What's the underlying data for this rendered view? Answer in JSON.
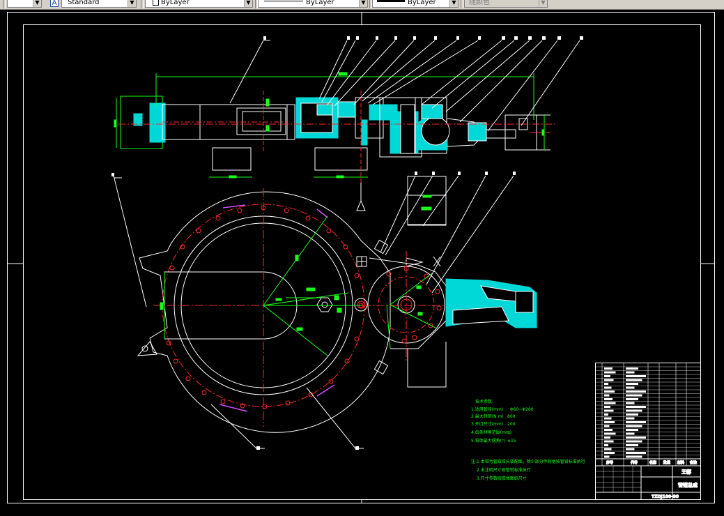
{
  "toolbar": {
    "text_style": {
      "value": "Standard"
    },
    "color_control": {
      "value": "ByLayer"
    },
    "linetype_control": {
      "value": "ByLayer"
    },
    "lineweight_control": {
      "value": "ByLayer"
    },
    "plotstyle_control": {
      "value": "随颜色"
    }
  },
  "icons": {
    "text_style_icon": "text-style-icon",
    "dropdown_arrow": "chevron-down-icon"
  },
  "colors": {
    "background": "#000000",
    "lines": "#ffffff",
    "dimensions": "#19ff19",
    "centerlines": "#ff2a2a",
    "section_fill": "#00d8d8",
    "leaders": "#ffffff",
    "accent_magenta": "#d24bff"
  },
  "drawing": {
    "notes": {
      "heading": "技术参数:",
      "lines": [
        {
          "label": "1.适用管径(mm)",
          "value": "Φ60~Φ200"
        },
        {
          "label": "2.最大转矩(N.m)",
          "value": "800"
        },
        {
          "label": "3.开口尺寸(mm)",
          "value": "200"
        },
        {
          "label": "4.齿条倾角范围(mm)",
          "value": "±"
        },
        {
          "label": "5.钳体最大摆角(°)",
          "value": "±15"
        }
      ],
      "remarks_heading": "注:",
      "remarks": [
        "1.本钳为管钳钳头装配图，除少部分件其他按管钳标准执行",
        "2.未注明尺寸按管钳标准执行",
        "3.尺寸参数按钳体图纸尺寸"
      ]
    },
    "title_block": {
      "col_headers": [
        "序号",
        "代号",
        "名称",
        "数量",
        "材料",
        "备注"
      ],
      "company": "王都",
      "drawing_title": "管钳总成",
      "drawing_number": "TZDJ100-00"
    }
  }
}
